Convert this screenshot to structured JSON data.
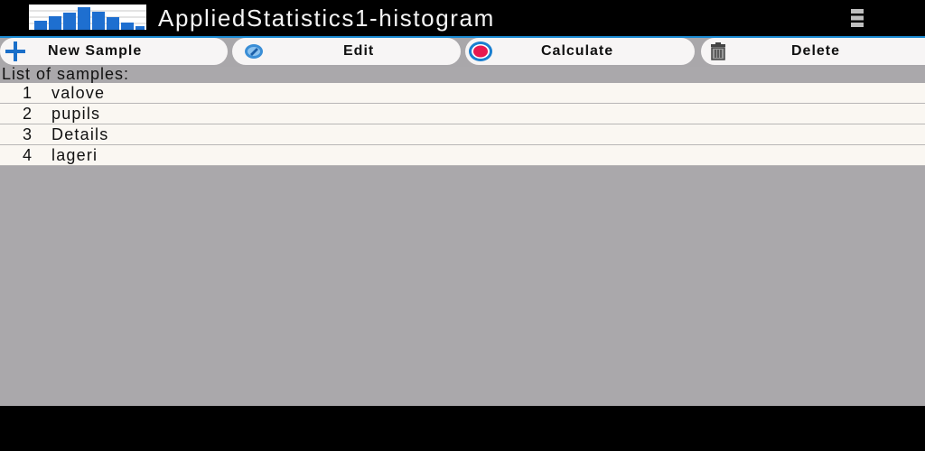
{
  "app": {
    "title": "AppliedStatistics1-histogram",
    "icon": "histogram-icon",
    "menu_icon": "overflow-menu-icon"
  },
  "colors": {
    "accent": "#1c8bd3",
    "histogram_bar": "#1e6fd0",
    "calculate_ring": "#1a7fd0",
    "calculate_dot": "#e8194f",
    "panel_background": "#aaa8ab",
    "row_background": "#faf7f2"
  },
  "toolbar": {
    "new_sample": {
      "label": "New Sample",
      "icon": "plus-icon"
    },
    "edit": {
      "label": "Edit",
      "icon": "pencil-icon"
    },
    "calculate": {
      "label": "Calculate",
      "icon": "target-icon"
    },
    "delete": {
      "label": "Delete",
      "icon": "trash-icon"
    }
  },
  "samples": {
    "header": "List of samples:",
    "items": [
      {
        "index": "1",
        "name": "valove"
      },
      {
        "index": "2",
        "name": "pupils"
      },
      {
        "index": "3",
        "name": "Details"
      },
      {
        "index": "4",
        "name": "lageri"
      }
    ]
  }
}
